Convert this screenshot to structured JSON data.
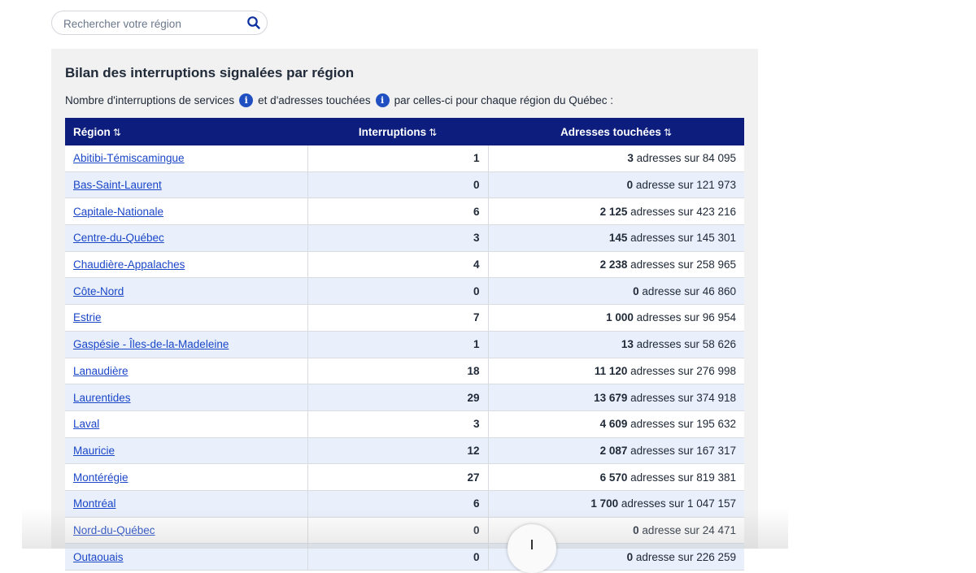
{
  "search": {
    "placeholder": "Rechercher votre région"
  },
  "panel": {
    "title": "Bilan des interruptions signalées par région",
    "desc_part1": "Nombre d'interruptions de services",
    "desc_part2": "et d'adresses touchées",
    "desc_part3": "par celles-ci pour chaque région du Québec :"
  },
  "table": {
    "headers": {
      "region": "Région",
      "interruptions": "Interruptions",
      "addresses": "Adresses touchées"
    },
    "sort_icon": "⇅",
    "rows": [
      {
        "region": "Abitibi-Témiscamingue",
        "interruptions": "1",
        "affected": "3",
        "rest": "adresses sur 84 095"
      },
      {
        "region": "Bas-Saint-Laurent",
        "interruptions": "0",
        "affected": "0",
        "rest": "adresse sur 121 973"
      },
      {
        "region": "Capitale-Nationale",
        "interruptions": "6",
        "affected": "2 125",
        "rest": "adresses sur 423 216"
      },
      {
        "region": "Centre-du-Québec",
        "interruptions": "3",
        "affected": "145",
        "rest": "adresses sur 145 301"
      },
      {
        "region": "Chaudière-Appalaches",
        "interruptions": "4",
        "affected": "2 238",
        "rest": "adresses sur 258 965"
      },
      {
        "region": "Côte-Nord",
        "interruptions": "0",
        "affected": "0",
        "rest": "adresse sur 46 860"
      },
      {
        "region": "Estrie",
        "interruptions": "7",
        "affected": "1 000",
        "rest": "adresses sur 96 954"
      },
      {
        "region": "Gaspésie - Îles-de-la-Madeleine",
        "interruptions": "1",
        "affected": "13",
        "rest": "adresses sur 58 626"
      },
      {
        "region": "Lanaudière",
        "interruptions": "18",
        "affected": "11 120",
        "rest": "adresses sur 276 998"
      },
      {
        "region": "Laurentides",
        "interruptions": "29",
        "affected": "13 679",
        "rest": "adresses sur 374 918"
      },
      {
        "region": "Laval",
        "interruptions": "3",
        "affected": "4 609",
        "rest": "adresses sur 195 632"
      },
      {
        "region": "Mauricie",
        "interruptions": "12",
        "affected": "2 087",
        "rest": "adresses sur 167 317"
      },
      {
        "region": "Montérégie",
        "interruptions": "27",
        "affected": "6 570",
        "rest": "adresses sur 819 381"
      },
      {
        "region": "Montréal",
        "interruptions": "6",
        "affected": "1 700",
        "rest": "adresses sur 1 047 157"
      },
      {
        "region": "Nord-du-Québec",
        "interruptions": "0",
        "affected": "0",
        "rest": "adresse sur 24 471"
      },
      {
        "region": "Outaouais",
        "interruptions": "0",
        "affected": "0",
        "rest": "adresse sur 226 259"
      }
    ]
  },
  "icons": {
    "search": "search-icon",
    "info": "info-icon",
    "sort": "sort-icon",
    "scroll": "arrow-down-icon"
  },
  "colors": {
    "header_bg": "#0c1d7e",
    "link": "#1a46c8",
    "info_icon": "#1f4fc0",
    "row_alt": "#e9f0fb",
    "panel_bg": "#f1f1f2"
  }
}
